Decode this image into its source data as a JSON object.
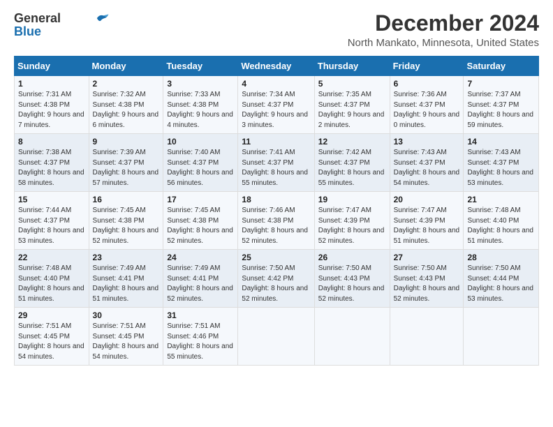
{
  "logo": {
    "line1": "General",
    "line2": "Blue"
  },
  "title": "December 2024",
  "subtitle": "North Mankato, Minnesota, United States",
  "headers": [
    "Sunday",
    "Monday",
    "Tuesday",
    "Wednesday",
    "Thursday",
    "Friday",
    "Saturday"
  ],
  "weeks": [
    [
      {
        "day": "1",
        "rise": "7:31 AM",
        "set": "4:38 PM",
        "daylight": "9 hours and 7 minutes"
      },
      {
        "day": "2",
        "rise": "7:32 AM",
        "set": "4:38 PM",
        "daylight": "9 hours and 6 minutes"
      },
      {
        "day": "3",
        "rise": "7:33 AM",
        "set": "4:38 PM",
        "daylight": "9 hours and 4 minutes"
      },
      {
        "day": "4",
        "rise": "7:34 AM",
        "set": "4:37 PM",
        "daylight": "9 hours and 3 minutes"
      },
      {
        "day": "5",
        "rise": "7:35 AM",
        "set": "4:37 PM",
        "daylight": "9 hours and 2 minutes"
      },
      {
        "day": "6",
        "rise": "7:36 AM",
        "set": "4:37 PM",
        "daylight": "9 hours and 0 minutes"
      },
      {
        "day": "7",
        "rise": "7:37 AM",
        "set": "4:37 PM",
        "daylight": "8 hours and 59 minutes"
      }
    ],
    [
      {
        "day": "8",
        "rise": "7:38 AM",
        "set": "4:37 PM",
        "daylight": "8 hours and 58 minutes"
      },
      {
        "day": "9",
        "rise": "7:39 AM",
        "set": "4:37 PM",
        "daylight": "8 hours and 57 minutes"
      },
      {
        "day": "10",
        "rise": "7:40 AM",
        "set": "4:37 PM",
        "daylight": "8 hours and 56 minutes"
      },
      {
        "day": "11",
        "rise": "7:41 AM",
        "set": "4:37 PM",
        "daylight": "8 hours and 55 minutes"
      },
      {
        "day": "12",
        "rise": "7:42 AM",
        "set": "4:37 PM",
        "daylight": "8 hours and 55 minutes"
      },
      {
        "day": "13",
        "rise": "7:43 AM",
        "set": "4:37 PM",
        "daylight": "8 hours and 54 minutes"
      },
      {
        "day": "14",
        "rise": "7:43 AM",
        "set": "4:37 PM",
        "daylight": "8 hours and 53 minutes"
      }
    ],
    [
      {
        "day": "15",
        "rise": "7:44 AM",
        "set": "4:37 PM",
        "daylight": "8 hours and 53 minutes"
      },
      {
        "day": "16",
        "rise": "7:45 AM",
        "set": "4:38 PM",
        "daylight": "8 hours and 52 minutes"
      },
      {
        "day": "17",
        "rise": "7:45 AM",
        "set": "4:38 PM",
        "daylight": "8 hours and 52 minutes"
      },
      {
        "day": "18",
        "rise": "7:46 AM",
        "set": "4:38 PM",
        "daylight": "8 hours and 52 minutes"
      },
      {
        "day": "19",
        "rise": "7:47 AM",
        "set": "4:39 PM",
        "daylight": "8 hours and 52 minutes"
      },
      {
        "day": "20",
        "rise": "7:47 AM",
        "set": "4:39 PM",
        "daylight": "8 hours and 51 minutes"
      },
      {
        "day": "21",
        "rise": "7:48 AM",
        "set": "4:40 PM",
        "daylight": "8 hours and 51 minutes"
      }
    ],
    [
      {
        "day": "22",
        "rise": "7:48 AM",
        "set": "4:40 PM",
        "daylight": "8 hours and 51 minutes"
      },
      {
        "day": "23",
        "rise": "7:49 AM",
        "set": "4:41 PM",
        "daylight": "8 hours and 51 minutes"
      },
      {
        "day": "24",
        "rise": "7:49 AM",
        "set": "4:41 PM",
        "daylight": "8 hours and 52 minutes"
      },
      {
        "day": "25",
        "rise": "7:50 AM",
        "set": "4:42 PM",
        "daylight": "8 hours and 52 minutes"
      },
      {
        "day": "26",
        "rise": "7:50 AM",
        "set": "4:43 PM",
        "daylight": "8 hours and 52 minutes"
      },
      {
        "day": "27",
        "rise": "7:50 AM",
        "set": "4:43 PM",
        "daylight": "8 hours and 52 minutes"
      },
      {
        "day": "28",
        "rise": "7:50 AM",
        "set": "4:44 PM",
        "daylight": "8 hours and 53 minutes"
      }
    ],
    [
      {
        "day": "29",
        "rise": "7:51 AM",
        "set": "4:45 PM",
        "daylight": "8 hours and 54 minutes"
      },
      {
        "day": "30",
        "rise": "7:51 AM",
        "set": "4:45 PM",
        "daylight": "8 hours and 54 minutes"
      },
      {
        "day": "31",
        "rise": "7:51 AM",
        "set": "4:46 PM",
        "daylight": "8 hours and 55 minutes"
      },
      null,
      null,
      null,
      null
    ]
  ],
  "labels": {
    "sunrise": "Sunrise:",
    "sunset": "Sunset:",
    "daylight": "Daylight:"
  }
}
